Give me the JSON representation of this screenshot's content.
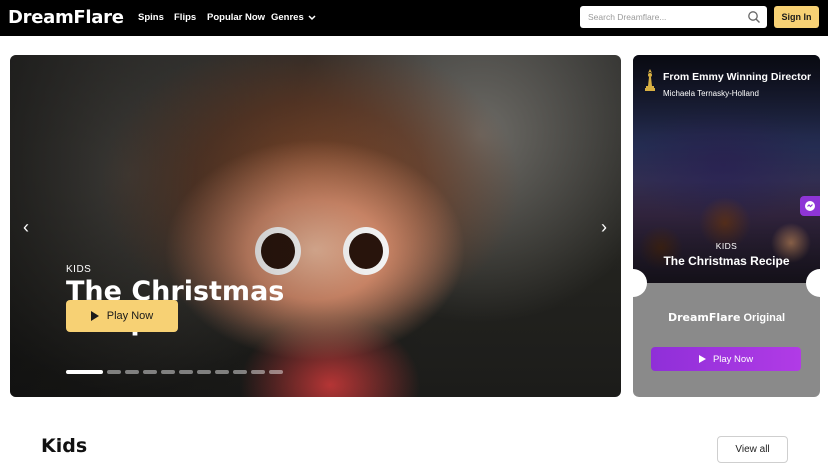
{
  "header": {
    "logo": "DreamFlare",
    "nav": [
      {
        "label": "Spins"
      },
      {
        "label": "Flips"
      },
      {
        "label": "Popular Now"
      },
      {
        "label": "Genres"
      }
    ],
    "search": {
      "placeholder": "Search Dreamflare...",
      "value": ""
    },
    "sign_in": "Sign In"
  },
  "hero": {
    "category": "KIDS",
    "title": "The Christmas Recipe",
    "play_label": "Play Now",
    "prev_arrow": "‹",
    "next_arrow": "›",
    "slide_count": 11,
    "active_slide": 1
  },
  "side_card": {
    "tagline": "From Emmy Winning Director",
    "director": "Michaela Ternasky-Holland",
    "category": "KIDS",
    "title": "The Christmas Recipe",
    "brand": "DreamFlare",
    "brand_suffix": " Original",
    "play_label": "Play Now",
    "icons": [
      "emmy-statuette-icon",
      "chat-bubble-icon"
    ]
  },
  "section": {
    "title": "Kids",
    "view_all": "View all"
  },
  "colors": {
    "accent_yellow": "#f7d174",
    "accent_purple": "#9b32dd",
    "nav_bg": "#000000"
  }
}
